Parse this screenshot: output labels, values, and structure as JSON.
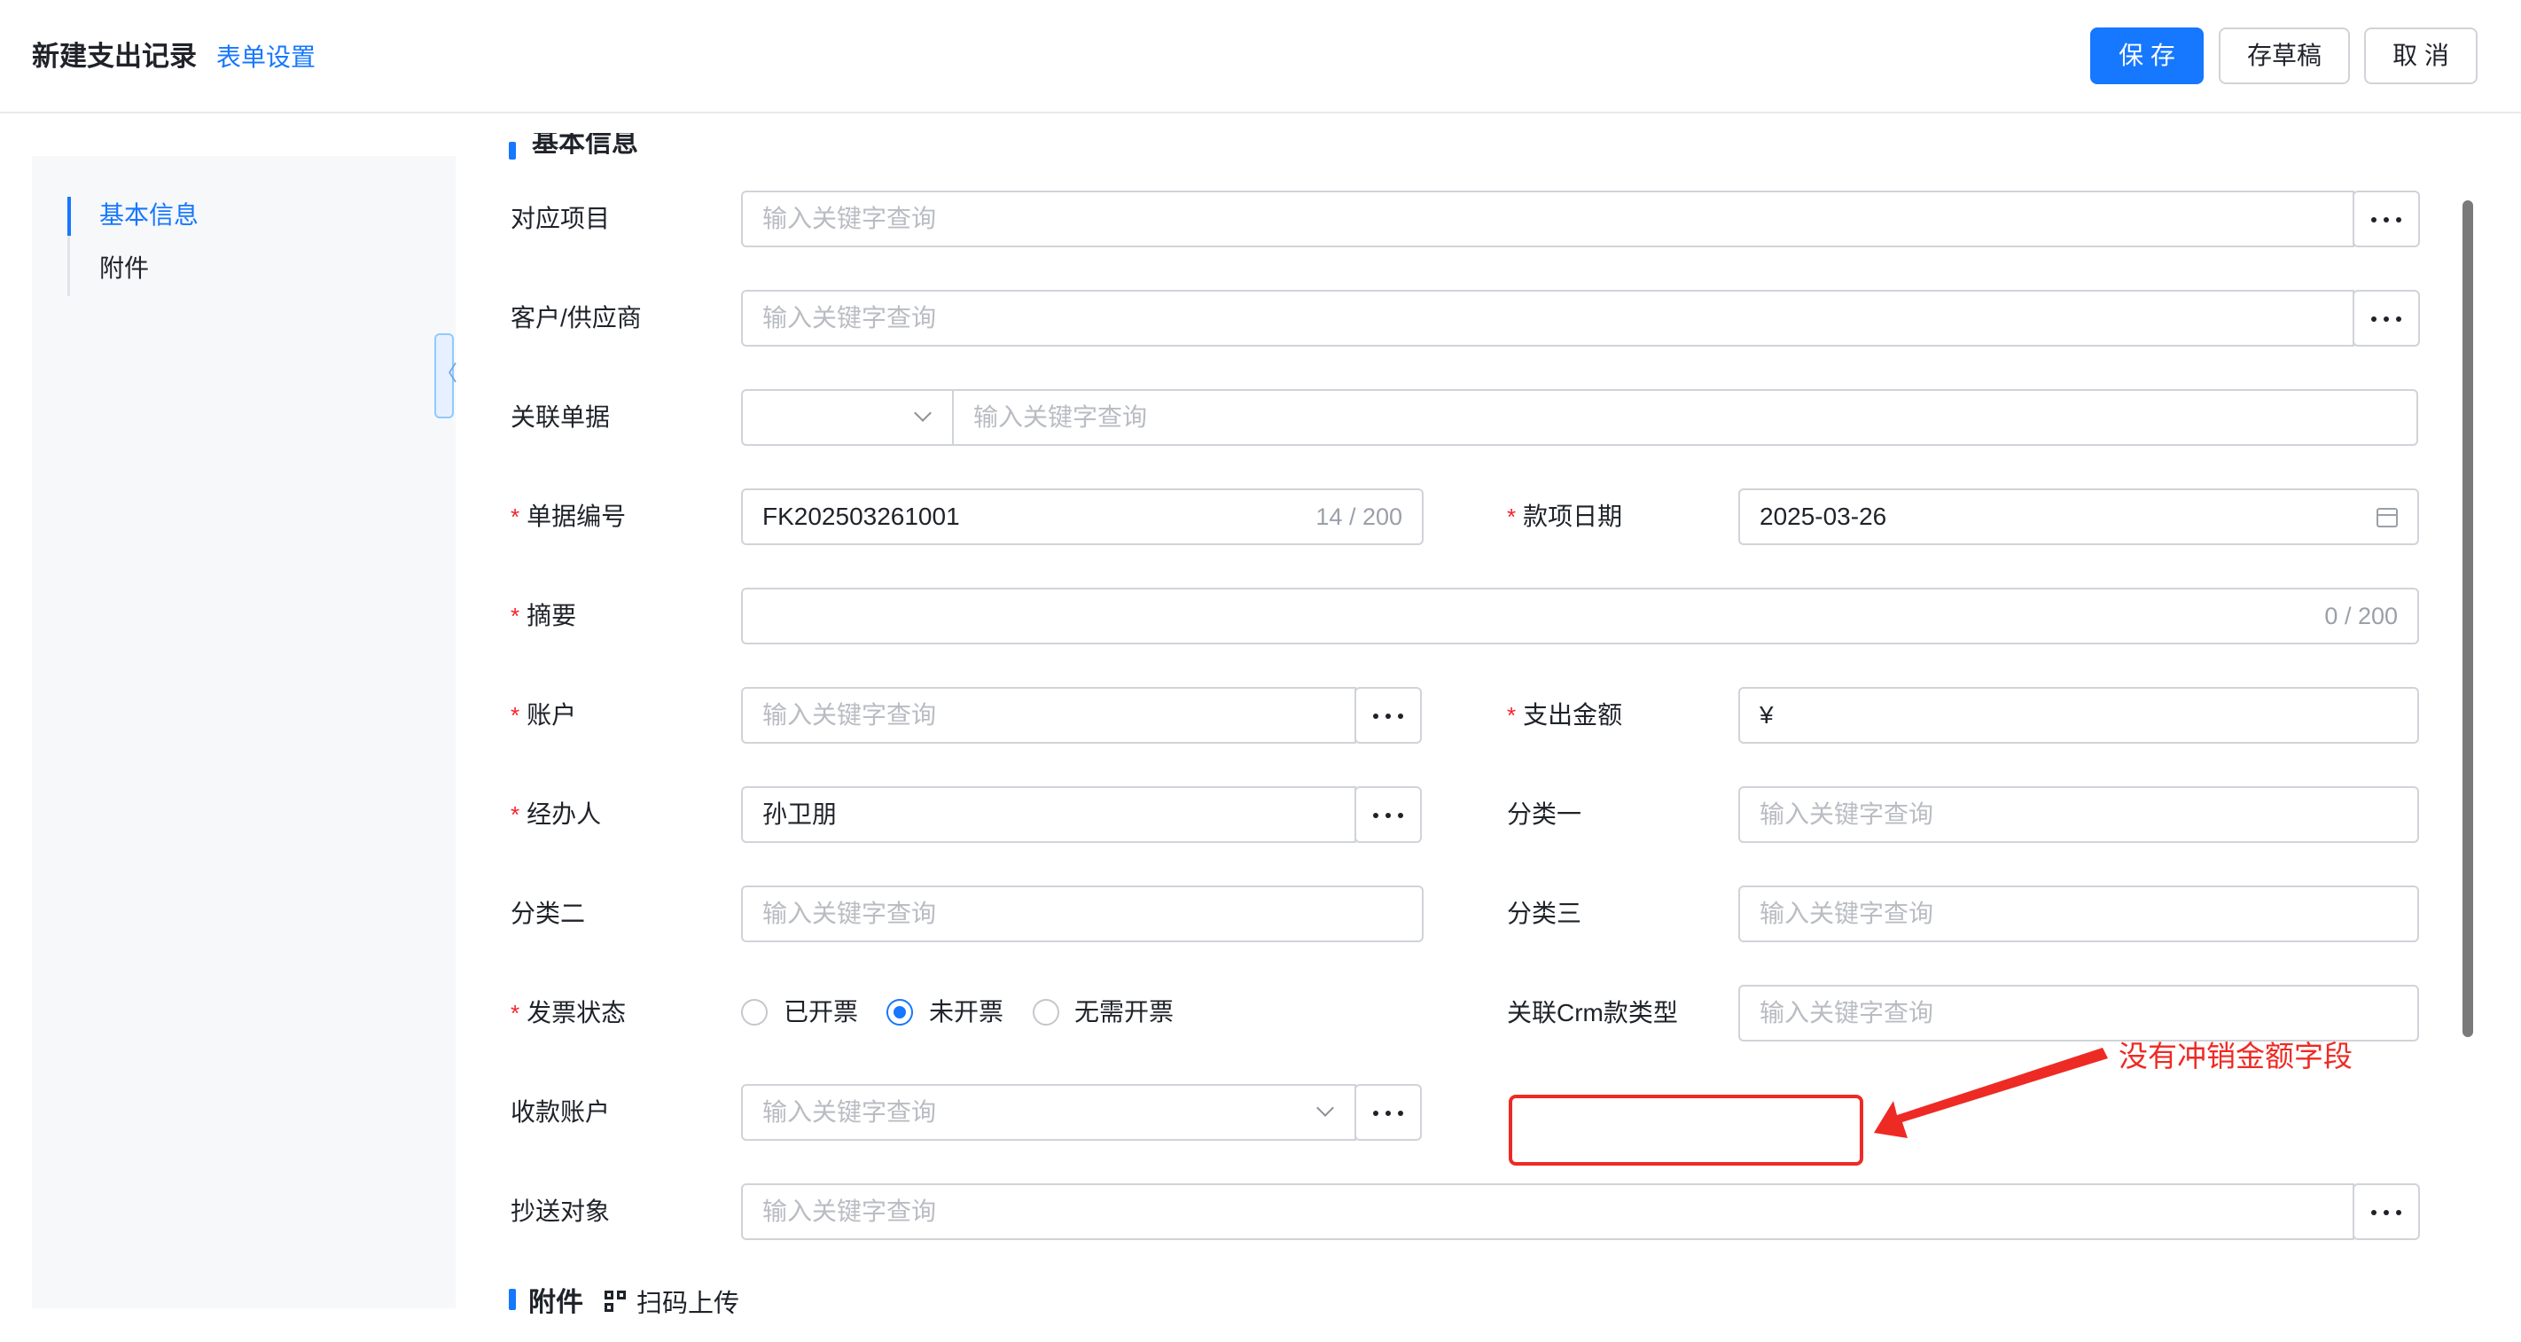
{
  "header": {
    "title": "新建支出记录",
    "form_settings": "表单设置",
    "buttons": {
      "save": "保 存",
      "draft": "存草稿",
      "cancel": "取 消"
    }
  },
  "sidebar": {
    "items": [
      {
        "label": "基本信息",
        "active": true
      },
      {
        "label": "附件",
        "active": false
      }
    ],
    "collapse_icon": "〈"
  },
  "section": {
    "basic_info": "基本信息"
  },
  "fields": {
    "project": {
      "label": "对应项目",
      "placeholder": "输入关键字查询"
    },
    "customer": {
      "label": "客户/供应商",
      "placeholder": "输入关键字查询"
    },
    "related_doc": {
      "label": "关联单据",
      "placeholder": "输入关键字查询"
    },
    "doc_no": {
      "label": "单据编号",
      "value": "FK202503261001",
      "counter": "14 / 200",
      "required": true
    },
    "date": {
      "label": "款项日期",
      "value": "2025-03-26",
      "required": true
    },
    "summary": {
      "label": "摘要",
      "counter": "0 / 200",
      "required": true
    },
    "account": {
      "label": "账户",
      "placeholder": "输入关键字查询",
      "required": true
    },
    "amount": {
      "label": "支出金额",
      "value": "¥",
      "required": true
    },
    "handler": {
      "label": "经办人",
      "value": "孙卫朋",
      "required": true
    },
    "category1": {
      "label": "分类一",
      "placeholder": "输入关键字查询"
    },
    "category2": {
      "label": "分类二",
      "placeholder": "输入关键字查询"
    },
    "category3": {
      "label": "分类三",
      "placeholder": "输入关键字查询"
    },
    "invoice_status": {
      "label": "发票状态",
      "required": true,
      "options": [
        "已开票",
        "未开票",
        "无需开票"
      ],
      "selected": "未开票"
    },
    "crm_type": {
      "label": "关联Crm款类型",
      "placeholder": "输入关键字查询"
    },
    "receive_account": {
      "label": "收款账户",
      "placeholder": "输入关键字查询"
    },
    "cc": {
      "label": "抄送对象",
      "placeholder": "输入关键字查询"
    }
  },
  "annotation": {
    "text": "没有冲销金额字段",
    "color": "#ee2a24"
  },
  "attachments": {
    "title": "附件",
    "scan_label": "扫码上传"
  },
  "colors": {
    "primary": "#1677ff",
    "required": "#f5222d",
    "annotation": "#ee2a24"
  }
}
